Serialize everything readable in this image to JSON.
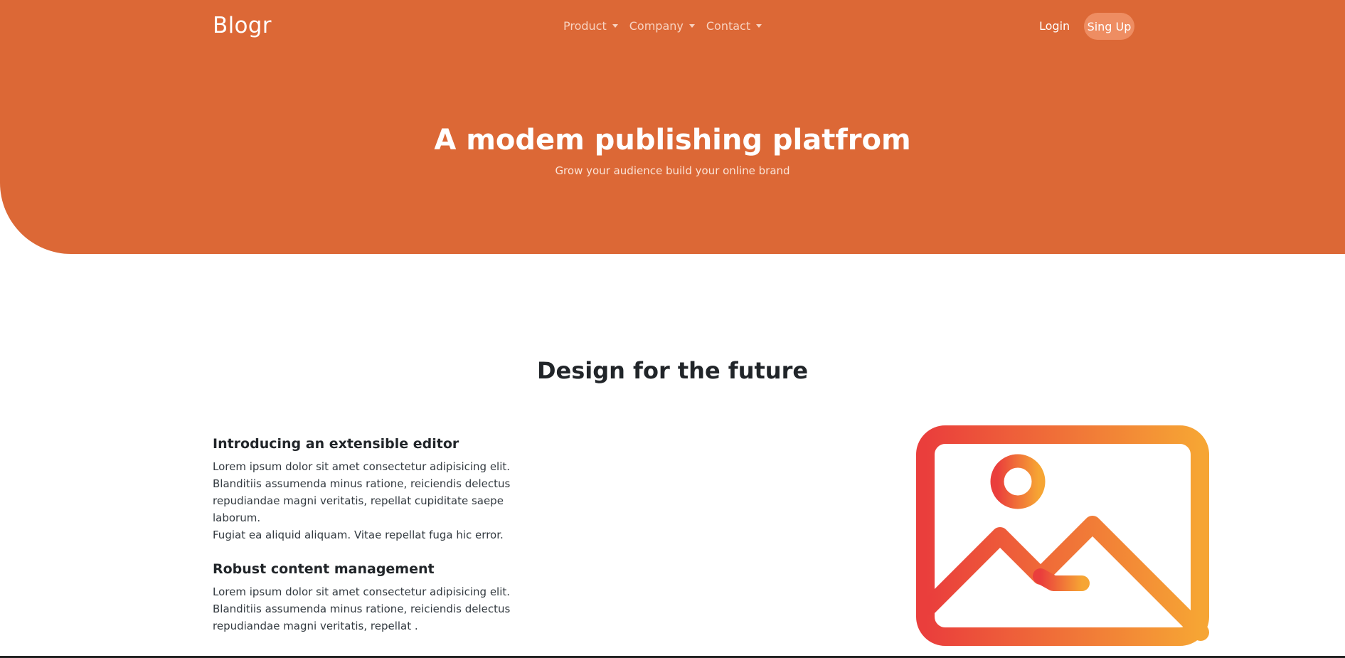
{
  "nav": {
    "brand": "Blogr",
    "menu": [
      {
        "label": "Product"
      },
      {
        "label": "Company"
      },
      {
        "label": "Contact"
      }
    ],
    "login_label": "Login",
    "signup_label": "Sing Up"
  },
  "hero": {
    "title": "A modem publishing platfrom",
    "subtitle": "Grow your audience build your online brand"
  },
  "features": {
    "section_title": "Design for the future",
    "items": [
      {
        "title": "Introducing an extensible editor",
        "body": "Lorem ipsum dolor sit amet consectetur adipisicing elit.\nBlanditiis assumenda minus ratione, reiciendis delectus\nrepudiandae magni veritatis, repellat cupiditate saepe laborum.\nFugiat ea aliquid aliquam. Vitae repellat fuga hic error."
      },
      {
        "title": "Robust content management",
        "body": "Lorem ipsum dolor sit amet consectetur adipisicing elit.\nBlanditiis assumenda minus ratione, reiciendis delectus\nrepudiandae magni veritatis, repellat ."
      }
    ],
    "illustration_icon": "image-icon"
  },
  "colors": {
    "brand": "#dc6836",
    "signup_bg": "#ee8d62",
    "gradient_start": "#ea3e3c",
    "gradient_end": "#f6a534"
  }
}
